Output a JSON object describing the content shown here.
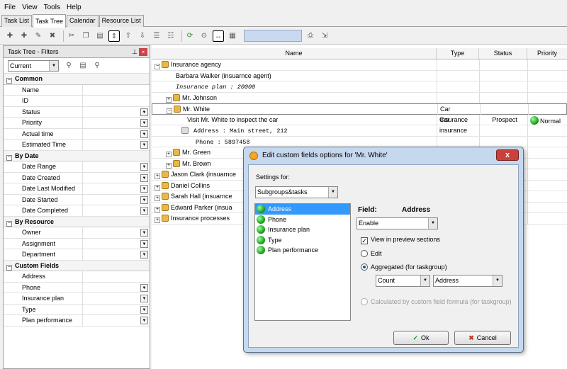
{
  "menu": [
    "File",
    "View",
    "Tools",
    "Help"
  ],
  "tabs": [
    "Task List",
    "Task Tree",
    "Calendar",
    "Resource List"
  ],
  "filters": {
    "title": "Task Tree - Filters",
    "current": "Current",
    "categories": [
      {
        "name": "Common",
        "items": [
          {
            "label": "Name",
            "dd": false
          },
          {
            "label": "ID",
            "dd": false
          },
          {
            "label": "Status",
            "dd": true
          },
          {
            "label": "Priority",
            "dd": true
          },
          {
            "label": "Actual time",
            "dd": true
          },
          {
            "label": "Estimated Time",
            "dd": true
          }
        ]
      },
      {
        "name": "By Date",
        "items": [
          {
            "label": "Date Range",
            "dd": true
          },
          {
            "label": "Date Created",
            "dd": true
          },
          {
            "label": "Date Last Modified",
            "dd": true
          },
          {
            "label": "Date Started",
            "dd": true
          },
          {
            "label": "Date Completed",
            "dd": true
          }
        ]
      },
      {
        "name": "By Resource",
        "items": [
          {
            "label": "Owner",
            "dd": true
          },
          {
            "label": "Assignment",
            "dd": true
          },
          {
            "label": "Department",
            "dd": true
          }
        ]
      },
      {
        "name": "Custom Fields",
        "items": [
          {
            "label": "Address",
            "dd": false
          },
          {
            "label": "Phone",
            "dd": true
          },
          {
            "label": "Insurance plan",
            "dd": true
          },
          {
            "label": "Type",
            "dd": true
          },
          {
            "label": "Plan performance",
            "dd": true
          }
        ]
      }
    ]
  },
  "grid": {
    "columns": [
      "Name",
      "Type",
      "Status",
      "Priority"
    ],
    "rows": [
      {
        "indent": 0,
        "text": "Insurance agency",
        "kind": "task",
        "toggle": "−"
      },
      {
        "indent": 2,
        "text": "Barbara Walker (insuarnce agent)",
        "kind": "plain"
      },
      {
        "indent": 2,
        "text": "Insurance plan : 20000",
        "kind": "note"
      },
      {
        "indent": 2,
        "text": "Mr. Johnson",
        "kind": "task",
        "toggle": "+"
      },
      {
        "indent": 2,
        "text": "Mr. White",
        "kind": "task",
        "toggle": "−",
        "type": "Car insurance",
        "selected": true
      },
      {
        "indent": 4,
        "text": "Visit Mr. White to inspect the car",
        "kind": "plain",
        "type": "Car insurance",
        "status": "Prospect",
        "priority": "Normal"
      },
      {
        "indent": 4,
        "text": "Address : Main street, 212",
        "kind": "note2"
      },
      {
        "indent": 4,
        "text": "Phone   : 5897458",
        "kind": "note3"
      },
      {
        "indent": 2,
        "text": "Mr. Green",
        "kind": "task",
        "toggle": "+"
      },
      {
        "indent": 2,
        "text": "Mr. Brown",
        "kind": "task",
        "toggle": "+"
      },
      {
        "indent": 0,
        "text": "Jason Clark (insuarnce",
        "kind": "task",
        "toggle": "+"
      },
      {
        "indent": 0,
        "text": "Daniel Collins",
        "kind": "task",
        "toggle": "+"
      },
      {
        "indent": 0,
        "text": "Sarah Hall (insuarnce",
        "kind": "task",
        "toggle": "+"
      },
      {
        "indent": 0,
        "text": "Edward Parker (insua",
        "kind": "task",
        "toggle": "+"
      },
      {
        "indent": 0,
        "text": "Insurance processes",
        "kind": "task",
        "toggle": "+"
      }
    ]
  },
  "dialog": {
    "title": "Edit custom fields options for  'Mr. White'",
    "close": "x",
    "settings_for_label": "Settings for:",
    "settings_for_value": "Subgroups&tasks",
    "fields": [
      "Address",
      "Phone",
      "Insurance plan",
      "Type",
      "Plan performance"
    ],
    "field_label": "Field:",
    "field_value": "Address",
    "mode": "Enable",
    "view_preview": "View in preview sections",
    "edit": "Edit",
    "aggregated": "Aggregated (for taskgroup)",
    "agg_func": "Count",
    "agg_field": "Address",
    "calculated": "Calculated by custom field formula (for taskgroup)",
    "ok": "Ok",
    "cancel": "Cancel"
  }
}
